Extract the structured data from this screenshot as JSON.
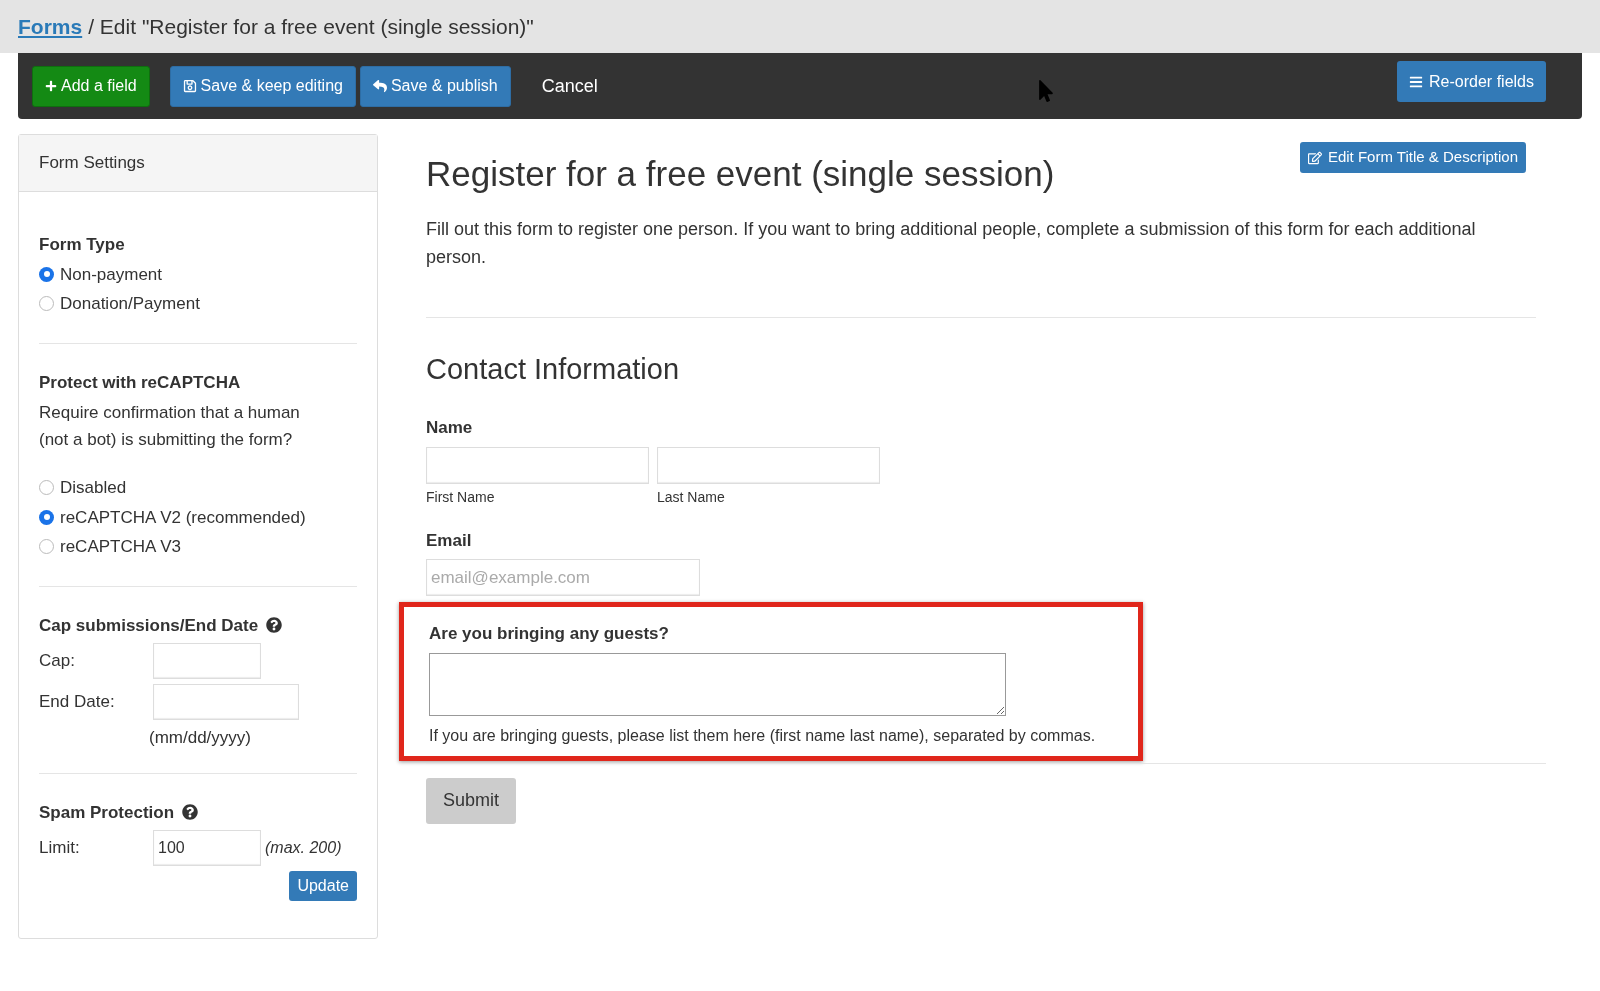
{
  "breadcrumb": {
    "link": "Forms",
    "text": "/ Edit \"Register for a free event (single session)\""
  },
  "toolbar": {
    "buttons": [
      {
        "label": "Add a field",
        "kind": "add"
      },
      {
        "label": "Save & keep editing",
        "kind": "save"
      },
      {
        "label": "Save & publish",
        "kind": "publish"
      },
      {
        "label": "Cancel",
        "kind": "cancel"
      }
    ],
    "reorder": "Re-order fields"
  },
  "sidebar": {
    "title": "Form Settings",
    "form_type": {
      "heading": "Form Type",
      "options": [
        {
          "label": "Non-payment",
          "selected": true
        },
        {
          "label": "Donation/Payment",
          "selected": false
        }
      ]
    },
    "recaptcha": {
      "heading": "Protect with reCAPTCHA",
      "description": "Require confirmation that a human (not a bot) is submitting the form?",
      "options": [
        {
          "label": "Disabled",
          "selected": false
        },
        {
          "label": "reCAPTCHA V2 (recommended)",
          "selected": true
        },
        {
          "label": "reCAPTCHA V3",
          "selected": false
        }
      ]
    },
    "cap": {
      "heading": "Cap submissions/End Date",
      "cap_label": "Cap:",
      "end_date_label": "End Date:",
      "date_hint": "(mm/dd/yyyy)"
    },
    "spam": {
      "heading": "Spam Protection",
      "limit_label": "Limit:",
      "limit_value": "100",
      "max_note": "(max. 200)",
      "update_button": "Update"
    }
  },
  "form": {
    "edit_button": "Edit Form Title & Description",
    "title": "Register for a free event (single session)",
    "description": "Fill out this form to register one person. If you want to bring additional people, complete a submission of this form for each additional person.",
    "section_heading": "Contact Information",
    "name": {
      "label": "Name",
      "first": "First Name",
      "last": "Last Name"
    },
    "email": {
      "label": "Email",
      "placeholder": "email@example.com"
    },
    "guests": {
      "label": "Are you bringing any guests?",
      "help": "If you are bringing guests, please list them here (first name last name), separated by commas.",
      "highlighted": true
    },
    "submit": "Submit"
  }
}
